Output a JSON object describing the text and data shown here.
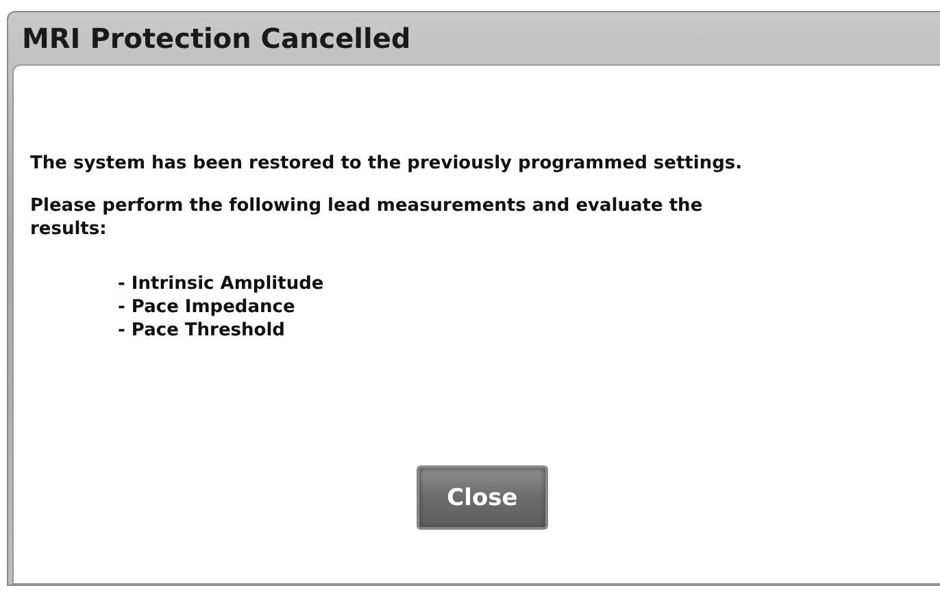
{
  "window": {
    "title": "MRI Protection Cancelled"
  },
  "message": "The system has been restored to the previously programmed settings.",
  "instruction": "Please perform the following lead measurements and evaluate the results:",
  "measurements": [
    "- Intrinsic Amplitude",
    "- Pace Impedance",
    "- Pace Threshold"
  ],
  "buttons": [
    "Close"
  ]
}
